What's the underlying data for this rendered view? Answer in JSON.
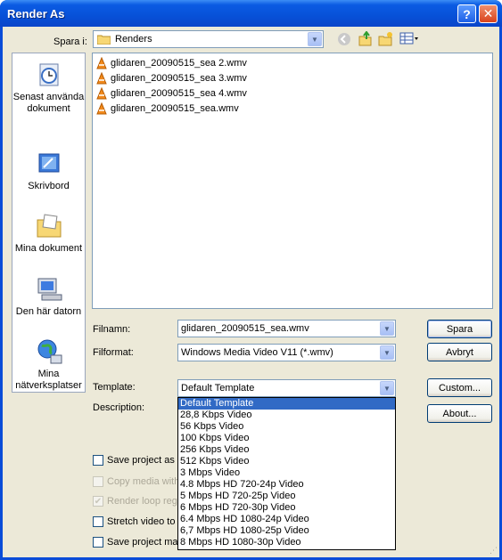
{
  "window": {
    "title": "Render As"
  },
  "toolbar": {
    "save_in_label": "Spara i:",
    "folder": "Renders"
  },
  "places": [
    {
      "label": "Senast använda dokument",
      "icon": "recent-documents-icon"
    },
    {
      "label": "Skrivbord",
      "icon": "desktop-icon"
    },
    {
      "label": "Mina dokument",
      "icon": "my-documents-icon"
    },
    {
      "label": "Den här datorn",
      "icon": "my-computer-icon"
    },
    {
      "label": "Mina nätverksplatser",
      "icon": "network-places-icon"
    }
  ],
  "files": [
    "glidaren_20090515_sea 2.wmv",
    "glidaren_20090515_sea 3.wmv",
    "glidaren_20090515_sea 4.wmv",
    "glidaren_20090515_sea.wmv"
  ],
  "form": {
    "filename_label": "Filnamn:",
    "filename_value": "glidaren_20090515_sea.wmv",
    "format_label": "Filformat:",
    "format_value": "Windows Media Video V11 (*.wmv)",
    "template_label": "Template:",
    "template_value": "Default Template",
    "description_label": "Description:"
  },
  "buttons": {
    "save": "Spara",
    "cancel": "Avbryt",
    "custom": "Custom...",
    "about": "About..."
  },
  "options": [
    {
      "label": "Save project as p",
      "checked": false,
      "enabled": true
    },
    {
      "label": "Copy media with",
      "checked": false,
      "enabled": false
    },
    {
      "label": "Render loop regi",
      "checked": true,
      "enabled": false
    },
    {
      "label": "Stretch video to",
      "checked": false,
      "enabled": true
    },
    {
      "label": "Save project mar",
      "checked": false,
      "enabled": true
    }
  ],
  "template_options": [
    "Default Template",
    "28,8 Kbps Video",
    "56 Kbps Video",
    "100 Kbps Video",
    "256 Kbps Video",
    "512 Kbps Video",
    "3 Mbps Video",
    "4.8 Mbps HD 720-24p Video",
    "5 Mbps HD 720-25p Video",
    "6 Mbps HD 720-30p Video",
    "6.4 Mbps HD 1080-24p Video",
    "6,7 Mbps HD 1080-25p Video",
    "8 Mbps HD 1080-30p Video"
  ],
  "selected_template_index": 0
}
